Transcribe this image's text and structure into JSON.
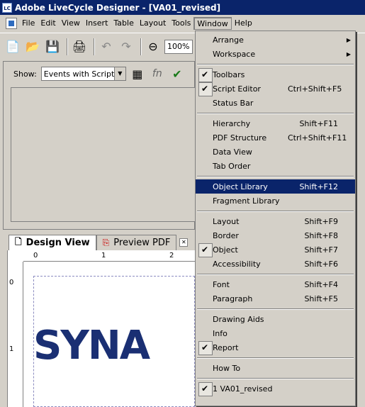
{
  "title": "Adobe LiveCycle Designer - [VA01_revised]",
  "title_icon": "LC",
  "menubar": [
    "File",
    "Edit",
    "View",
    "Insert",
    "Table",
    "Layout",
    "Tools",
    "Window",
    "Help"
  ],
  "toolbar": {
    "zoom": "100%"
  },
  "script_panel": {
    "show_label": "Show:",
    "show_value": "Events with Scripts"
  },
  "doc_tabs": {
    "design": "Design View",
    "preview": "Preview PDF"
  },
  "ruler": {
    "h1": "0",
    "h2": "1",
    "h3": "2",
    "v1": "0",
    "v2": "1"
  },
  "logo_text": "SYNA",
  "window_menu": {
    "arrange": "Arrange",
    "workspace": "Workspace",
    "toolbars": "Toolbars",
    "script_editor": "Script Editor",
    "script_editor_sc": "Ctrl+Shift+F5",
    "status_bar": "Status Bar",
    "hierarchy": "Hierarchy",
    "hierarchy_sc": "Shift+F11",
    "pdf_structure": "PDF Structure",
    "pdf_structure_sc": "Ctrl+Shift+F11",
    "data_view": "Data View",
    "tab_order": "Tab Order",
    "object_library": "Object Library",
    "object_library_sc": "Shift+F12",
    "fragment_library": "Fragment Library",
    "layout": "Layout",
    "layout_sc": "Shift+F9",
    "border": "Border",
    "border_sc": "Shift+F8",
    "object": "Object",
    "object_sc": "Shift+F7",
    "accessibility": "Accessibility",
    "accessibility_sc": "Shift+F6",
    "font": "Font",
    "font_sc": "Shift+F4",
    "paragraph": "Paragraph",
    "paragraph_sc": "Shift+F5",
    "drawing_aids": "Drawing Aids",
    "info": "Info",
    "report": "Report",
    "how_to": "How To",
    "recent": "1 VA01_revised"
  },
  "colors": {
    "titlebar": "#0a246a",
    "highlight": "#0a246a",
    "face": "#d4d0c8"
  }
}
